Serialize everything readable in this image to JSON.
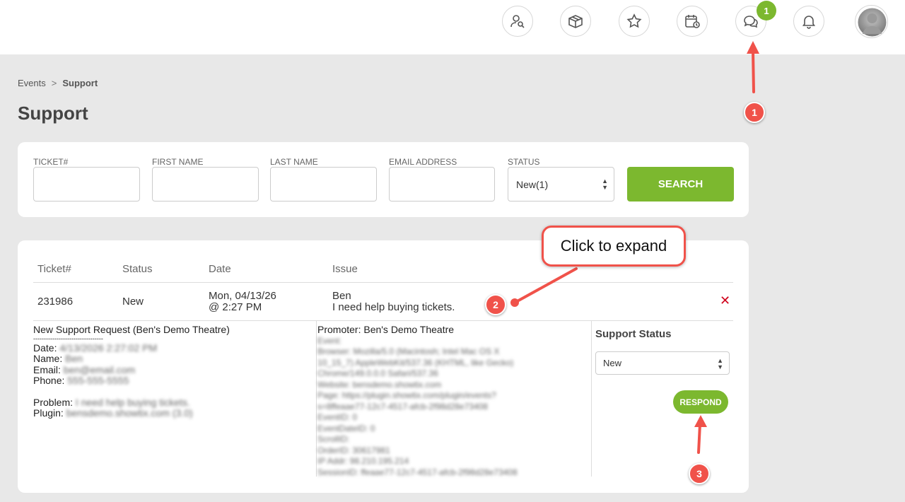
{
  "header": {
    "icons": [
      "user-search-icon",
      "box-icon",
      "star-icon",
      "calendar-clock-icon",
      "chat-icon",
      "bell-icon"
    ],
    "chat_badge": "1"
  },
  "breadcrumb": {
    "parent": "Events",
    "separator": ">",
    "current": "Support"
  },
  "page_title": "Support",
  "search": {
    "ticket_label": "TICKET#",
    "first_name_label": "FIRST NAME",
    "last_name_label": "LAST NAME",
    "email_label": "EMAIL ADDRESS",
    "status_label": "STATUS",
    "status_value": "New(1)",
    "search_button": "SEARCH"
  },
  "table": {
    "headers": [
      "Ticket#",
      "Status",
      "Date",
      "Issue"
    ],
    "row": {
      "ticket": "231986",
      "status": "New",
      "date_line1": "Mon, 04/13/26",
      "date_line2": "@ 2:27 PM",
      "issue_name": "Ben",
      "issue_text": "I need help buying tickets."
    }
  },
  "detail": {
    "request_title": "New Support Request (Ben's Demo Theatre)",
    "divider": "---------------------------------",
    "date_label": "Date:",
    "date_value": "4/13/2026 2:27:02 PM",
    "name_label": "Name:",
    "name_value": "Ben",
    "email_label": "Email:",
    "email_value": "ben@email.com",
    "phone_label": "Phone:",
    "phone_value": "555-555-5555",
    "problem_label": "Problem:",
    "problem_value": "I need help buying tickets.",
    "plugin_label": "Plugin:",
    "plugin_value": "bensdemo.showtix.com (3.0)",
    "promoter": "Promoter: Ben's Demo Theatre",
    "meta_lines": [
      "Event:",
      "Browser: Mozilla/5.0 (Macintosh; Intel Mac OS X",
      "10_15_7) AppleWebKit/537.36 (KHTML, like Gecko)",
      "Chrome/149.0.0.0 Safari/537.36",
      "Website: bensdemo.showtix.com",
      "Page: https://plugin.showtix.com/plugin/events?",
      "s=8ffeaae77-12c7-4517-afcb-2f98d28e73408",
      "EventID: 0",
      "EventDateID: 0",
      "ScrollID:",
      "OrderID: 30617981",
      "IP Addr: 98.210.195.214",
      "SessionID: ffeaae77-12c7-4517-afcb-2f98d28e73408"
    ],
    "support_status_label": "Support Status",
    "support_status_value": "New",
    "respond_button": "RESPOND"
  },
  "annotations": {
    "step1": "1",
    "step2": "2",
    "step3": "3",
    "callout": "Click to expand"
  },
  "colors": {
    "accent": "#7cb82f",
    "annotation": "#f0524a",
    "delete": "#d0021b"
  }
}
